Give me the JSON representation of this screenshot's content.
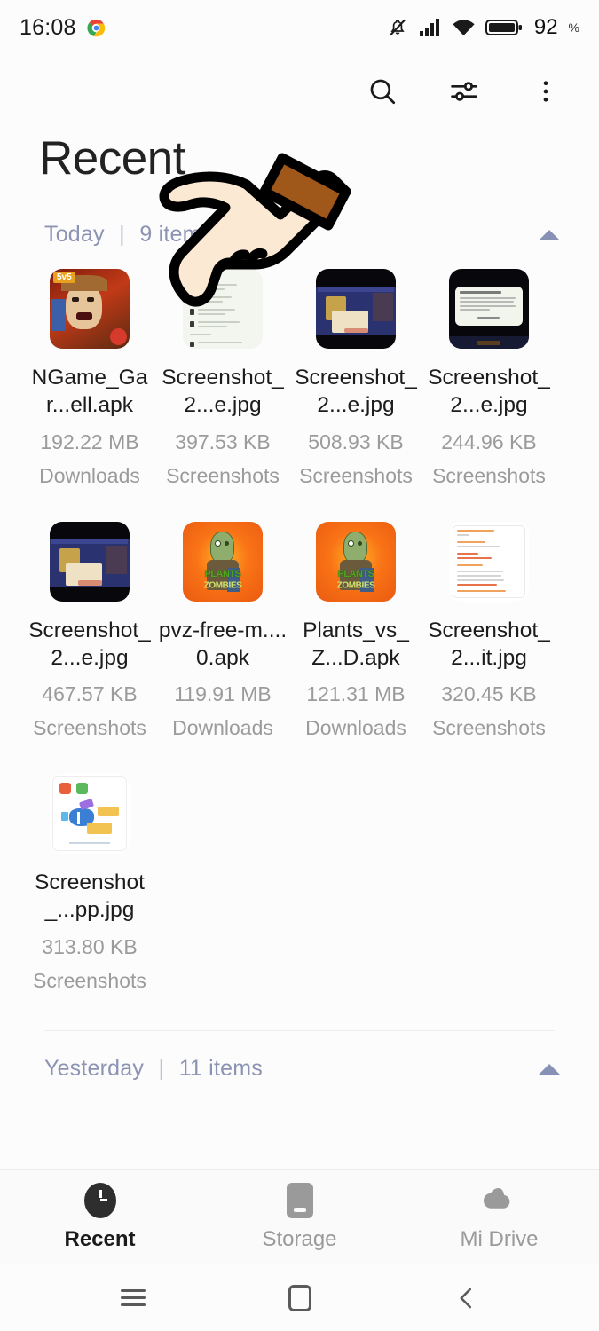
{
  "status_bar": {
    "time": "16:08",
    "app_icon": "chrome-icon",
    "icons": [
      "silent-bell-icon",
      "signal-bars-icon",
      "wifi-icon",
      "battery-icon"
    ],
    "battery_percent": "92",
    "battery_unit": "%"
  },
  "toolbar": {
    "search_label": "search-icon",
    "filter_label": "filter-sliders-icon",
    "more_label": "overflow-menu-icon"
  },
  "header": {
    "title": "Recent"
  },
  "sections": [
    {
      "label": "Today",
      "separator": "|",
      "count": "9 items",
      "collapsed": false
    },
    {
      "label": "Yesterday",
      "separator": "|",
      "count": "11 items",
      "collapsed": false
    }
  ],
  "files": [
    {
      "name": "NGame_Gar...ell.apk",
      "size": "192.22 MB",
      "location": "Downloads",
      "thumb": "game-hero"
    },
    {
      "name": "Screenshot_2...e.jpg",
      "size": "397.53 KB",
      "location": "Screenshots",
      "thumb": "doc-list"
    },
    {
      "name": "Screenshot_2...e.jpg",
      "size": "508.93 KB",
      "location": "Screenshots",
      "thumb": "game-dark"
    },
    {
      "name": "Screenshot_2...e.jpg",
      "size": "244.96 KB",
      "location": "Screenshots",
      "thumb": "dialog-dark"
    },
    {
      "name": "Screenshot_2...e.jpg",
      "size": "467.57 KB",
      "location": "Screenshots",
      "thumb": "game-dark"
    },
    {
      "name": "pvz-free-m....0.apk",
      "size": "119.91 MB",
      "location": "Downloads",
      "thumb": "pvz"
    },
    {
      "name": "Plants_vs_Z...D.apk",
      "size": "121.31 MB",
      "location": "Downloads",
      "thumb": "pvz"
    },
    {
      "name": "Screenshot_2...it.jpg",
      "size": "320.45 KB",
      "location": "Screenshots",
      "thumb": "receipt"
    },
    {
      "name": "Screenshot_...pp.jpg",
      "size": "313.80 KB",
      "location": "Screenshots",
      "thumb": "cloud"
    }
  ],
  "bottom_nav": [
    {
      "label": "Recent",
      "icon": "clock-icon",
      "active": true
    },
    {
      "label": "Storage",
      "icon": "phone-icon",
      "active": false
    },
    {
      "label": "Mi Drive",
      "icon": "cloud-icon",
      "active": false
    }
  ],
  "system_nav": [
    {
      "icon": "recents-menu-icon"
    },
    {
      "icon": "home-square-icon"
    },
    {
      "icon": "back-chevron-icon"
    }
  ],
  "cursor": {
    "type": "pointing-hand-cursor",
    "hand_color": "#FCE9D4",
    "sleeve_color": "#A0571A",
    "outline_color": "#000000"
  },
  "colors": {
    "background": "#FCFCFC",
    "section_header": "#8C93B3",
    "file_name": "#1C1C1C",
    "file_meta": "#9B9B9B",
    "nav_active": "#1A1A1A",
    "nav_idle": "#9A9A9A"
  }
}
